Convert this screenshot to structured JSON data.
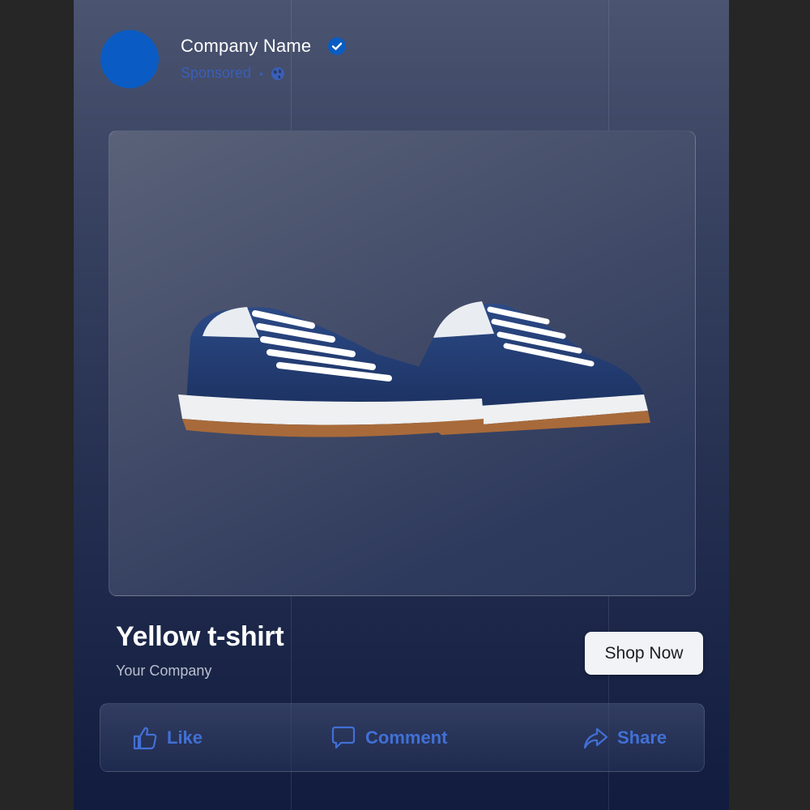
{
  "post": {
    "company_name": "Company Name",
    "sponsored_label": "Sponsored",
    "separator": "•",
    "verified_icon": "verified-check-icon",
    "audience_icon": "globe-icon"
  },
  "product": {
    "title": "Yellow t-shirt",
    "company": "Your Company",
    "cta_label": "Shop Now",
    "image": "sneakers-photo"
  },
  "actions": {
    "like": "Like",
    "comment": "Comment",
    "share": "Share"
  },
  "colors": {
    "avatar": "#0a5cc4",
    "accent": "#4170d6",
    "sponsored": "#3a5fb8"
  }
}
